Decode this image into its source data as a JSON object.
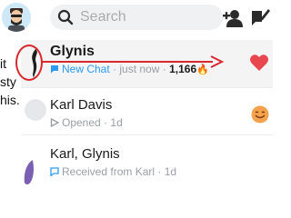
{
  "search": {
    "placeholder": "Search"
  },
  "side_caption": {
    "lines": [
      "it",
      "sty",
      "his."
    ]
  },
  "chats": [
    {
      "name": "Glynis",
      "status": "New Chat",
      "time": "just now",
      "streak_count": "1,166",
      "streak_emoji": "🔥",
      "badge": "heart-icon"
    },
    {
      "name": "Karl Davis",
      "status": "Opened",
      "time": "1d",
      "badge": "smile-face-icon"
    },
    {
      "name": "Karl, Glynis",
      "status": "Received from Karl",
      "time": "1d"
    }
  ],
  "separator": "·",
  "colors": {
    "accent_blue": "#2a9cf1",
    "annotation_red": "#d9272e",
    "heart": "#e8474f",
    "smile": "#f4a24e"
  }
}
